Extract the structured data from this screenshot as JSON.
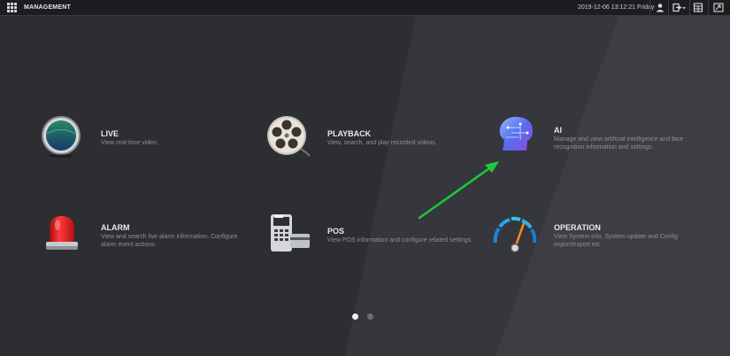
{
  "header": {
    "title": "MANAGEMENT",
    "datetime": "2019-12-06 13:12:21 Friday",
    "icons": [
      "grid-menu-icon",
      "user-icon",
      "logout-icon",
      "layout-icon",
      "exit-fullscreen-icon"
    ]
  },
  "tiles": [
    {
      "id": "live",
      "title": "LIVE",
      "desc": "View real-time video.",
      "icon": "live-icon"
    },
    {
      "id": "playback",
      "title": "PLAYBACK",
      "desc": "View, search, and play recorded videos.",
      "icon": "film-reel-icon"
    },
    {
      "id": "ai",
      "title": "AI",
      "desc": "Manage and view artificial intelligence and face recognition information and settings.",
      "icon": "ai-brain-icon"
    },
    {
      "id": "alarm",
      "title": "ALARM",
      "desc": "View and search live alarm information. Configure alarm event actions.",
      "icon": "alarm-light-icon"
    },
    {
      "id": "pos",
      "title": "POS",
      "desc": "View POS information and configure related settings.",
      "icon": "pos-terminal-icon"
    },
    {
      "id": "operation",
      "title": "OPERATION",
      "desc": "View System info, System update and Config import/export etc.",
      "icon": "gauge-icon"
    }
  ],
  "pagination": {
    "pages": 2,
    "current": 1
  },
  "colors": {
    "accent_arrow": "#22c83a",
    "topbar_bg": "#1c1d21",
    "panel_bg": "#2f3136"
  }
}
